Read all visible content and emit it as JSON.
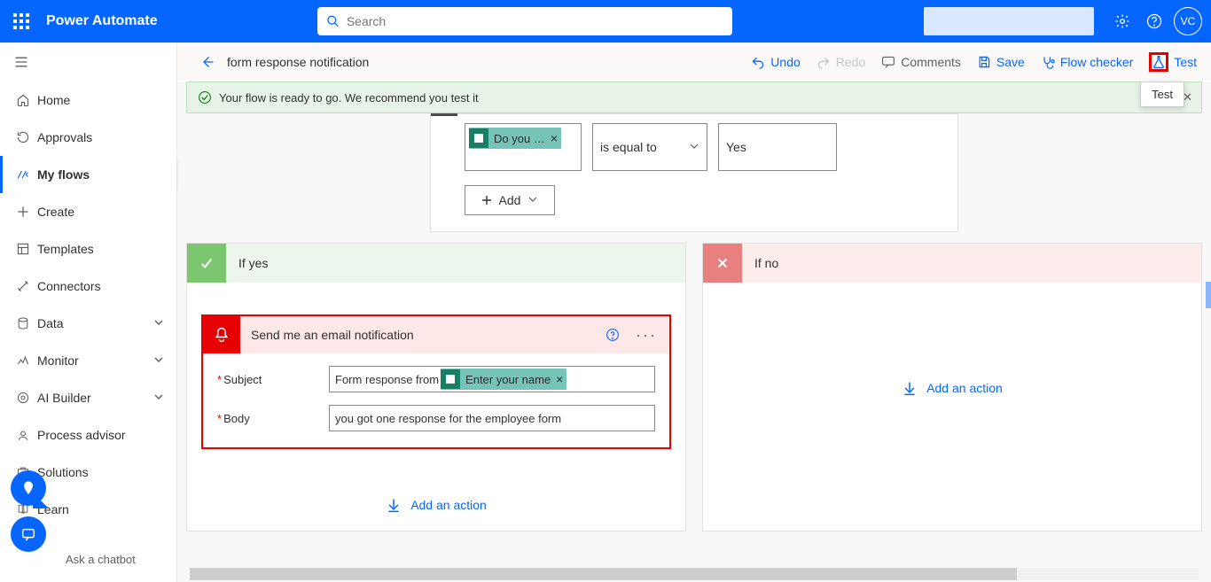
{
  "brand": "Power Automate",
  "search": {
    "placeholder": "Search"
  },
  "avatar": "VC",
  "sidebar": {
    "items": [
      {
        "label": "Home"
      },
      {
        "label": "Approvals"
      },
      {
        "label": "My flows"
      },
      {
        "label": "Create"
      },
      {
        "label": "Templates"
      },
      {
        "label": "Connectors"
      },
      {
        "label": "Data"
      },
      {
        "label": "Monitor"
      },
      {
        "label": "AI Builder"
      },
      {
        "label": "Process advisor"
      },
      {
        "label": "Solutions"
      },
      {
        "label": "Learn"
      }
    ],
    "chatbot": "Ask a chatbot"
  },
  "cmdbar": {
    "flow_name": "form response notification",
    "undo": "Undo",
    "redo": "Redo",
    "comments": "Comments",
    "save": "Save",
    "checker": "Flow checker",
    "test": "Test"
  },
  "banner": "Your flow is ready to go. We recommend you test it",
  "test_tooltip": "Test",
  "condition": {
    "left_token": "Do you …",
    "operator": "is equal to",
    "right_value": "Yes",
    "add_label": "Add"
  },
  "branches": {
    "yes_label": "If yes",
    "no_label": "If no",
    "add_action": "Add an action"
  },
  "email_action": {
    "title": "Send me an email notification",
    "subject_label": "Subject",
    "subject_prefix": "Form response from",
    "subject_token": "Enter your name",
    "body_label": "Body",
    "body_value": "you got one response for the employee form"
  }
}
